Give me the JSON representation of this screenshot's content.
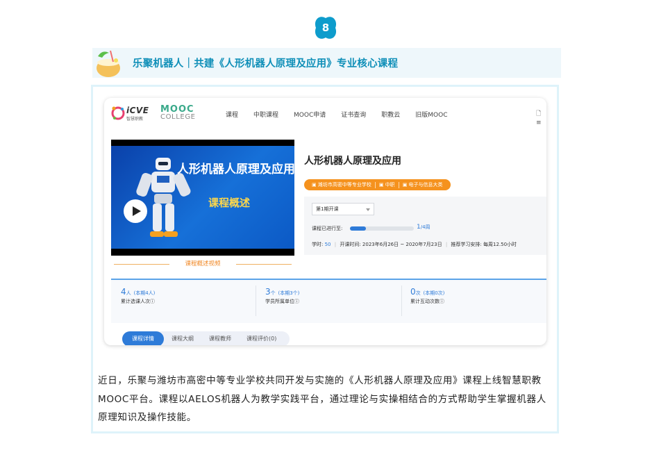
{
  "section": {
    "number": "8",
    "heading": "乐聚机器人｜共建《人形机器人原理及应用》专业核心课程",
    "badge_color": "#0e9ccc",
    "heading_color": "#0f8fb8"
  },
  "screenshot": {
    "nav": {
      "logo_icve": "iCVE",
      "logo_icve_sub": "智慧职教",
      "logo_mooc": "MOOC",
      "logo_college": "COLLEGE",
      "items": [
        "课程",
        "中职课程",
        "MOOC申请",
        "证书查询",
        "职教云",
        "旧版MOOC"
      ],
      "right": "🗋 ≡"
    },
    "video": {
      "title": "人形机器人原理及应用",
      "subtitle": "课程概述",
      "caption": "课程概述视频"
    },
    "course": {
      "title": "人形机器人原理及应用",
      "tags": [
        "潍坊市高密中等专业学校",
        "中职",
        "电子与信息大类"
      ],
      "session_select": "第1期开课",
      "progress_label": "课程已进行至:",
      "progress_value": 0.25,
      "progress_current": "1",
      "progress_total": "/4周",
      "hours_label": "学时:",
      "hours_value": "50",
      "period": "开课时间: 2023年6月26日 ~ 2020年7月23日",
      "schedule": "推荐学习安排: 每周12.50小时"
    },
    "stats": [
      {
        "count": "4",
        "unit": "人",
        "note": "(本期4人)",
        "desc": "累计选课人次ⓘ"
      },
      {
        "count": "3",
        "unit": "个",
        "note": "(本期3个)",
        "desc": "学员所属单位ⓘ"
      },
      {
        "count": "0",
        "unit": "次",
        "note": "(本期0次)",
        "desc": "累计互动次数ⓘ"
      }
    ],
    "tabs": [
      "课程详情",
      "课程大纲",
      "课程教师",
      "课程评价(0)"
    ],
    "accent": "#2e7bd8",
    "orange": "#f5921e"
  },
  "paragraph": "近日，乐聚与潍坊市高密中等专业学校共同开发与实施的《人形机器人原理及应用》课程上线智慧职教MOOC平台。课程以AELOS机器人为教学实践平台，通过理论与实操相结合的方式帮助学生掌握机器人原理知识及操作技能。"
}
